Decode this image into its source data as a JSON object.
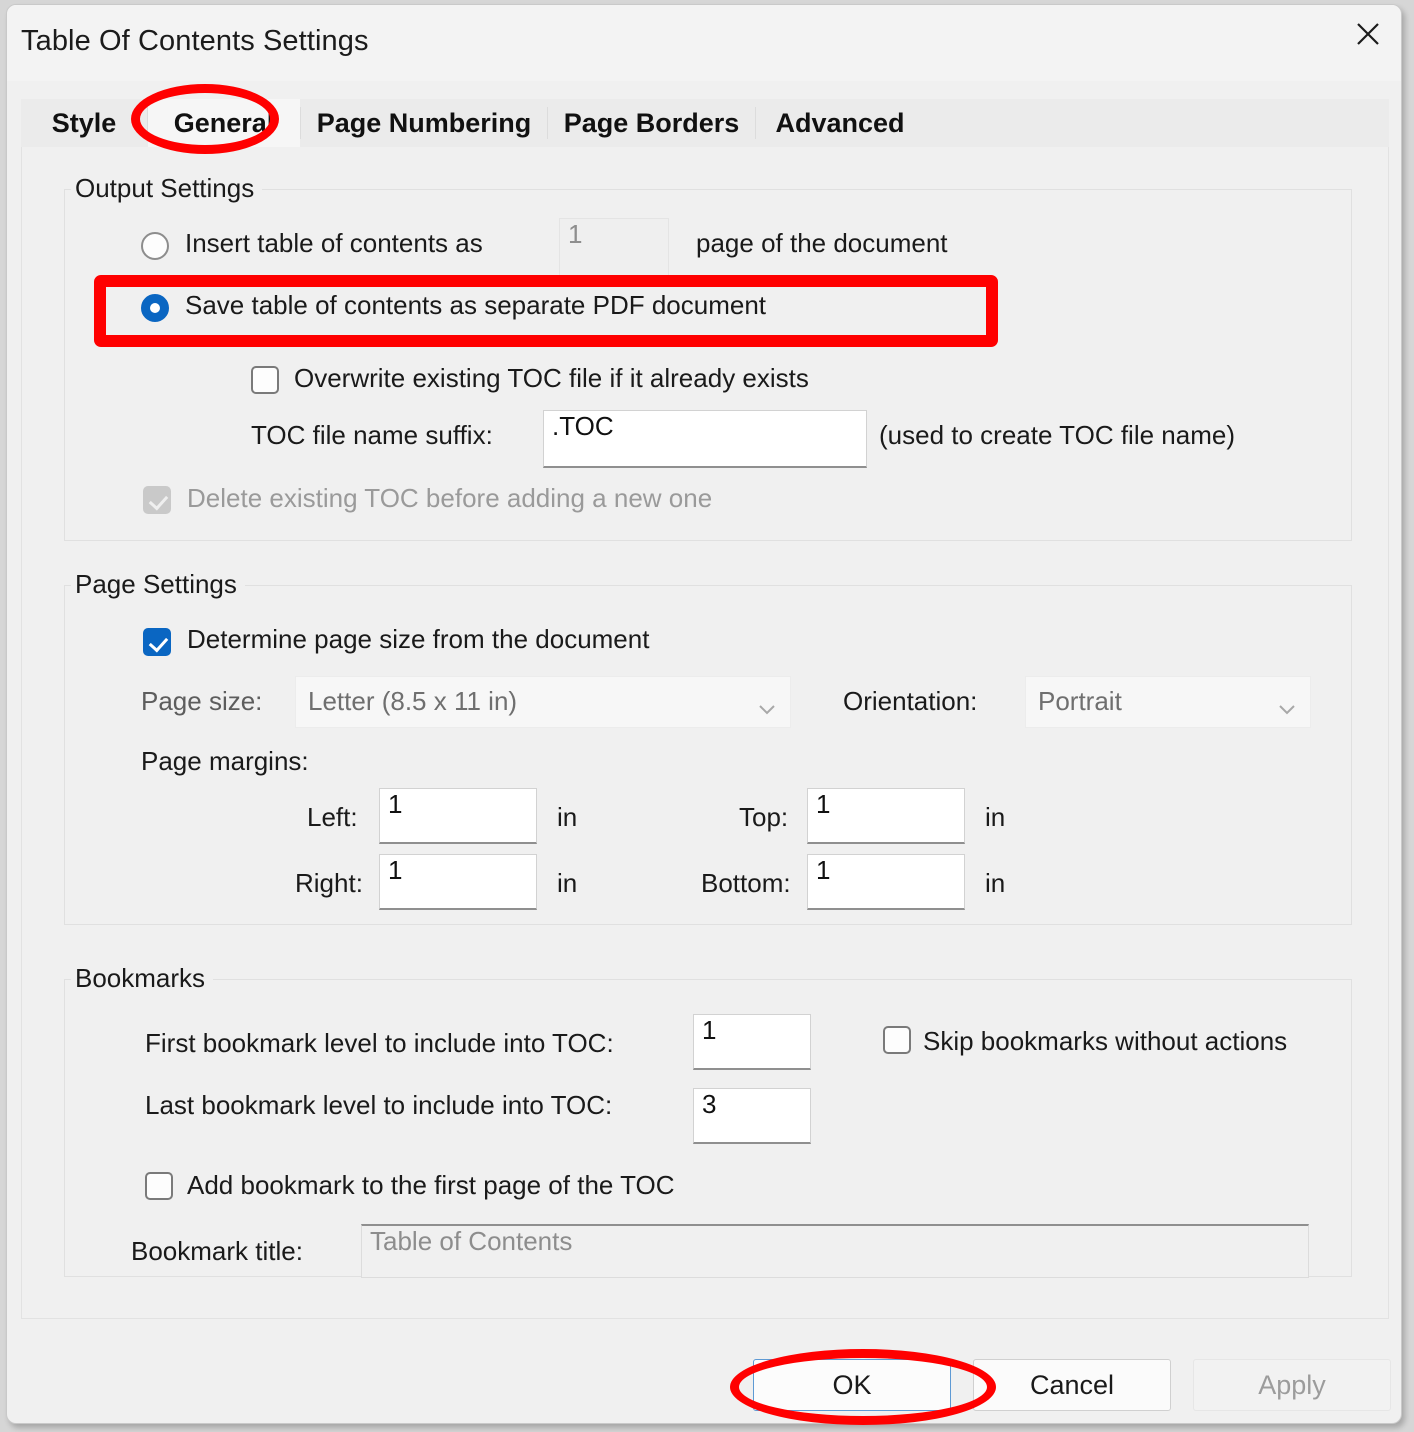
{
  "window": {
    "title": "Table Of Contents Settings",
    "close_icon": "close-icon"
  },
  "tabs": [
    {
      "label": "Style",
      "selected": false
    },
    {
      "label": "General",
      "selected": true
    },
    {
      "label": "Page Numbering",
      "selected": false
    },
    {
      "label": "Page Borders",
      "selected": false
    },
    {
      "label": "Advanced",
      "selected": false
    }
  ],
  "output_settings": {
    "group_label": "Output Settings",
    "insert_toc_label": "Insert table of contents as",
    "insert_toc_page_value": "1",
    "insert_toc_suffix_label": "page of the document",
    "save_separate_label": "Save table of contents as separate PDF document",
    "overwrite_label": "Overwrite existing TOC file if it already exists",
    "suffix_label": "TOC file name suffix:",
    "suffix_value": ".TOC",
    "suffix_hint": "(used to create TOC file name)",
    "delete_existing_label": "Delete existing TOC before adding a new one"
  },
  "page_settings": {
    "group_label": "Page Settings",
    "determine_label": "Determine page size from the document",
    "page_size_label": "Page size:",
    "page_size_value": "Letter (8.5 x 11 in)",
    "orientation_label": "Orientation:",
    "orientation_value": "Portrait",
    "margins_label": "Page margins:",
    "left_label": "Left:",
    "left_value": "1",
    "left_unit": "in",
    "top_label": "Top:",
    "top_value": "1",
    "top_unit": "in",
    "right_label": "Right:",
    "right_value": "1",
    "right_unit": "in",
    "bottom_label": "Bottom:",
    "bottom_value": "1",
    "bottom_unit": "in"
  },
  "bookmarks": {
    "group_label": "Bookmarks",
    "first_level_label": "First bookmark level to include into TOC:",
    "first_level_value": "1",
    "skip_label": "Skip bookmarks without actions",
    "last_level_label": "Last bookmark level to include into TOC:",
    "last_level_value": "3",
    "add_bookmark_label": "Add bookmark to the first page of the TOC",
    "bookmark_title_label": "Bookmark title:",
    "bookmark_title_placeholder": "Table of Contents"
  },
  "footer": {
    "ok_label": "OK",
    "cancel_label": "Cancel",
    "apply_label": "Apply"
  },
  "annotations": {
    "accent_color": "#ff0000",
    "highlight_general_tab": true,
    "highlight_save_separate_radio": true,
    "highlight_ok_button": true
  }
}
